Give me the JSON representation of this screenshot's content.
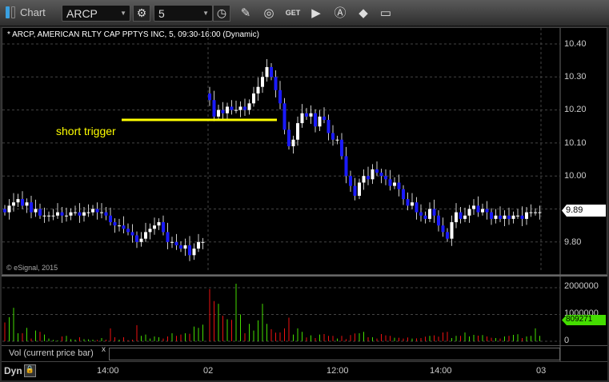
{
  "window": {
    "title": "Chart"
  },
  "toolbar": {
    "symbol": "ARCP",
    "interval": "5"
  },
  "chart": {
    "header": "* ARCP, AMERICAN RLTY CAP PPTYS INC, 5, 09:30-16:00 (Dynamic)",
    "copyright": "© eSignal, 2015",
    "annotation": "short trigger",
    "trigger_price": 10.17,
    "last_price_label": "9.89",
    "price_ticks": [
      "10.40",
      "10.30",
      "10.20",
      "10.10",
      "10.00",
      "9.80"
    ],
    "time_ticks": [
      "14:00",
      "02",
      "12:00",
      "14:00",
      "03"
    ],
    "colors": {
      "up": "#ffffff",
      "down": "#1a1aff",
      "trigger": "#ffff00",
      "vol_up": "#44dd00",
      "vol_down": "#ee1111"
    }
  },
  "chart_data": {
    "type": "candlestick",
    "ylim": [
      9.72,
      10.45
    ],
    "day1_closes": [
      9.89,
      9.91,
      9.92,
      9.93,
      9.91,
      9.92,
      9.89,
      9.9,
      9.88,
      9.88,
      9.88,
      9.88,
      9.89,
      9.88,
      9.88,
      9.89,
      9.89,
      9.88,
      9.89,
      9.89,
      9.9,
      9.89,
      9.89,
      9.88,
      9.86,
      9.85,
      9.85,
      9.84,
      9.83,
      9.82,
      9.8,
      9.81,
      9.83,
      9.84,
      9.85,
      9.86,
      9.83,
      9.8,
      9.8,
      9.79,
      9.78,
      9.79,
      9.76,
      9.78,
      9.8,
      9.8
    ],
    "day2_closes": [
      10.23,
      10.18,
      10.2,
      10.19,
      10.21,
      10.2,
      10.2,
      10.21,
      10.2,
      10.22,
      10.25,
      10.27,
      10.3,
      10.33,
      10.3,
      10.26,
      10.22,
      10.14,
      10.09,
      10.11,
      10.16,
      10.19,
      10.18,
      10.19,
      10.15,
      10.18,
      10.17,
      10.13,
      10.11,
      10.11,
      10.06,
      10.0,
      9.97,
      9.94,
      9.98,
      10.0,
      9.99,
      10.02,
      10.01,
      10.0,
      9.99,
      9.97,
      9.98,
      9.96,
      9.93,
      9.91,
      9.92,
      9.89,
      9.88,
      9.87,
      9.9,
      9.88,
      9.85,
      9.83,
      9.81,
      9.86,
      9.89,
      9.87,
      9.88,
      9.9,
      9.91,
      9.89,
      9.9,
      9.89,
      9.87,
      9.88,
      9.87,
      9.88,
      9.87,
      9.88,
      9.88,
      9.87,
      9.89,
      9.89,
      9.89,
      9.89
    ],
    "volume": [
      700000,
      900000,
      1250000,
      300000,
      300000,
      500000,
      100000,
      400000,
      350000,
      250000,
      100000,
      50000,
      30000,
      180000,
      200000,
      80000,
      60000,
      150000,
      80000,
      70000,
      60000,
      50000,
      120000,
      60000,
      480000,
      150000,
      60000,
      150000,
      40000,
      60000,
      600000,
      200000,
      250000,
      100000,
      180000,
      150000,
      100000,
      180000,
      300000,
      200000,
      250000,
      300000,
      280000,
      550000,
      500000,
      620000,
      1950000,
      1500000,
      1400000,
      950000,
      820000,
      800000,
      2150000,
      1000000,
      300000,
      650000,
      400000,
      780000,
      1400000,
      650000,
      450000,
      320000,
      330000,
      480000,
      880000,
      250000,
      480000,
      350000,
      140000,
      220000,
      120000,
      250000,
      270000,
      200000,
      200000,
      100000,
      200000,
      80000,
      230000,
      290000,
      300000,
      350000,
      150000,
      150000,
      100000,
      270000,
      220000,
      200000,
      130000,
      130000,
      100000,
      140000,
      100000,
      110000,
      120000,
      170000,
      200000,
      220000,
      170000,
      330000,
      350000,
      120000,
      200000,
      200000,
      330000,
      180000,
      240000,
      210000,
      230000,
      180000,
      130000,
      120000,
      100000,
      180000,
      200000,
      240000,
      260000,
      120000,
      180000,
      200000,
      480000,
      200000,
      809271
    ],
    "volume_ticks": [
      "2000000",
      "1000000",
      "0"
    ],
    "volume_label": "809271",
    "volume_panel_label": "Vol (current price bar)"
  },
  "footer": {
    "dyn_label": "Dyn"
  }
}
